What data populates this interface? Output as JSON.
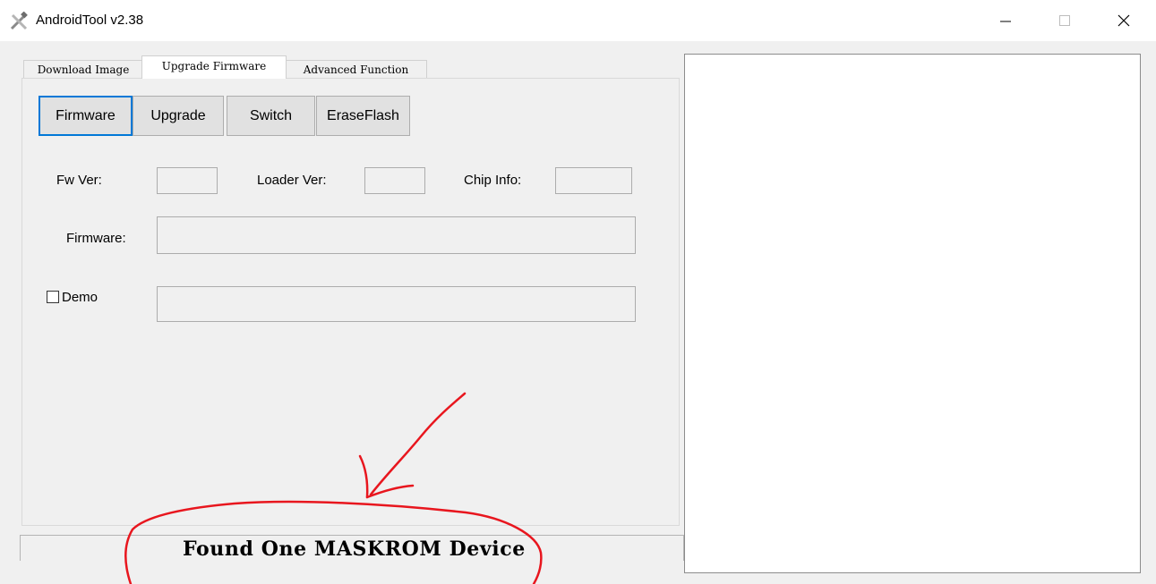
{
  "window": {
    "title": "AndroidTool v2.38",
    "icon": "tools-icon",
    "controls": [
      "minimize-icon",
      "maximize-icon",
      "close-icon"
    ]
  },
  "tabs": [
    {
      "label": "Download Image",
      "active": false
    },
    {
      "label": "Upgrade Firmware",
      "active": true
    },
    {
      "label": "Advanced Function",
      "active": false
    }
  ],
  "buttons": {
    "firmware": "Firmware",
    "upgrade": "Upgrade",
    "switch": "Switch",
    "erase_flash": "EraseFlash"
  },
  "info": {
    "fw_ver_label": "Fw Ver:",
    "loader_ver_label": "Loader Ver:",
    "chip_info_label": "Chip Info:",
    "fw_ver_value": "",
    "loader_ver_value": "",
    "chip_info_value": ""
  },
  "firmware": {
    "label": "Firmware:",
    "path": ""
  },
  "demo": {
    "label": "Demo",
    "checked": false,
    "path": ""
  },
  "status": {
    "message": "Found One MASKROM Device"
  },
  "colors": {
    "annotation": "#e8161e",
    "focus": "#0078d7"
  }
}
